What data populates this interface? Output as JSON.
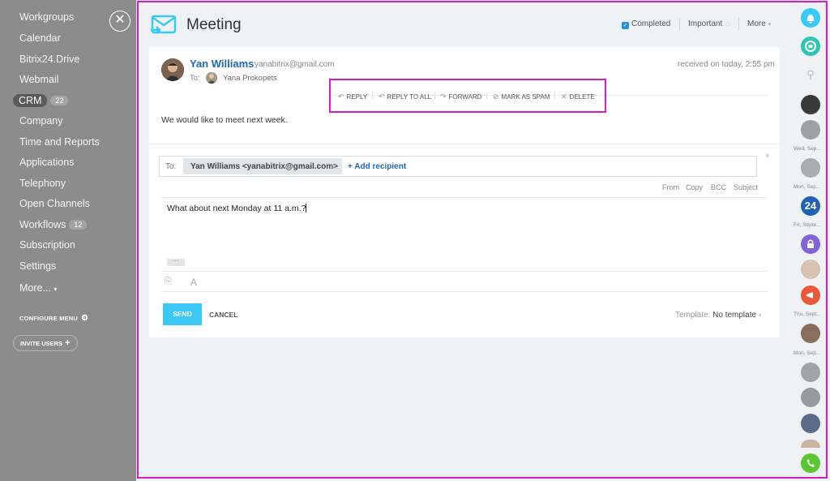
{
  "sidebar": {
    "items": [
      {
        "label": "Workgroups"
      },
      {
        "label": "Calendar"
      },
      {
        "label": "Bitrix24.Drive"
      },
      {
        "label": "Webmail"
      },
      {
        "label": "CRM",
        "badge": "22"
      },
      {
        "label": "Company"
      },
      {
        "label": "Time and Reports"
      },
      {
        "label": "Applications"
      },
      {
        "label": "Telephony"
      },
      {
        "label": "Open Channels"
      },
      {
        "label": "Workflows",
        "badge": "12"
      },
      {
        "label": "Subscription"
      },
      {
        "label": "Settings"
      },
      {
        "label": "More...",
        "suffix": "▾"
      }
    ],
    "configure_menu": "CONFIGURE MENU",
    "invite_users": "INVITE USERS",
    "close_glyph": "✕"
  },
  "header": {
    "title": "Meeting",
    "completed_label": "Completed",
    "important_label": "Important",
    "more_label": "More"
  },
  "message": {
    "sender_name": "Yan Williams",
    "sender_email": "yanabitrix@gmail.com",
    "to_label": "To:",
    "recipient_name": "Yana Prokopets",
    "received": "received on today, 2:55 pm",
    "body": "We would like to meet next week."
  },
  "actions": {
    "reply": "REPLY",
    "reply_all": "REPLY TO ALL",
    "forward": "FORWARD",
    "spam": "MARK AS SPAM",
    "delete": "DELETE"
  },
  "compose": {
    "to_label": "To:",
    "recipient_chip": "Yan Williams <yanabitrix@gmail.com>",
    "add_recipient": "+ Add recipient",
    "options": [
      "From",
      "Copy",
      "BCC",
      "Subject"
    ],
    "text": "What about next Monday at 11 a.m.?",
    "more_dots": "···",
    "send_label": "SEND",
    "cancel_label": "CANCEL",
    "template_label": "Template:",
    "template_value": "No template"
  },
  "rail": {
    "labels": [
      "Wed, Sep...",
      "Mon, Sep...",
      "Fri, Septe...",
      "Thu, Sept...",
      "Mon, Sep..."
    ],
    "bitrix_badge": "24"
  },
  "colors": {
    "accent": "#3bc8f5",
    "link": "#2067b0",
    "highlight": "#d71dc7",
    "sidebar": "#8c8c8c"
  }
}
